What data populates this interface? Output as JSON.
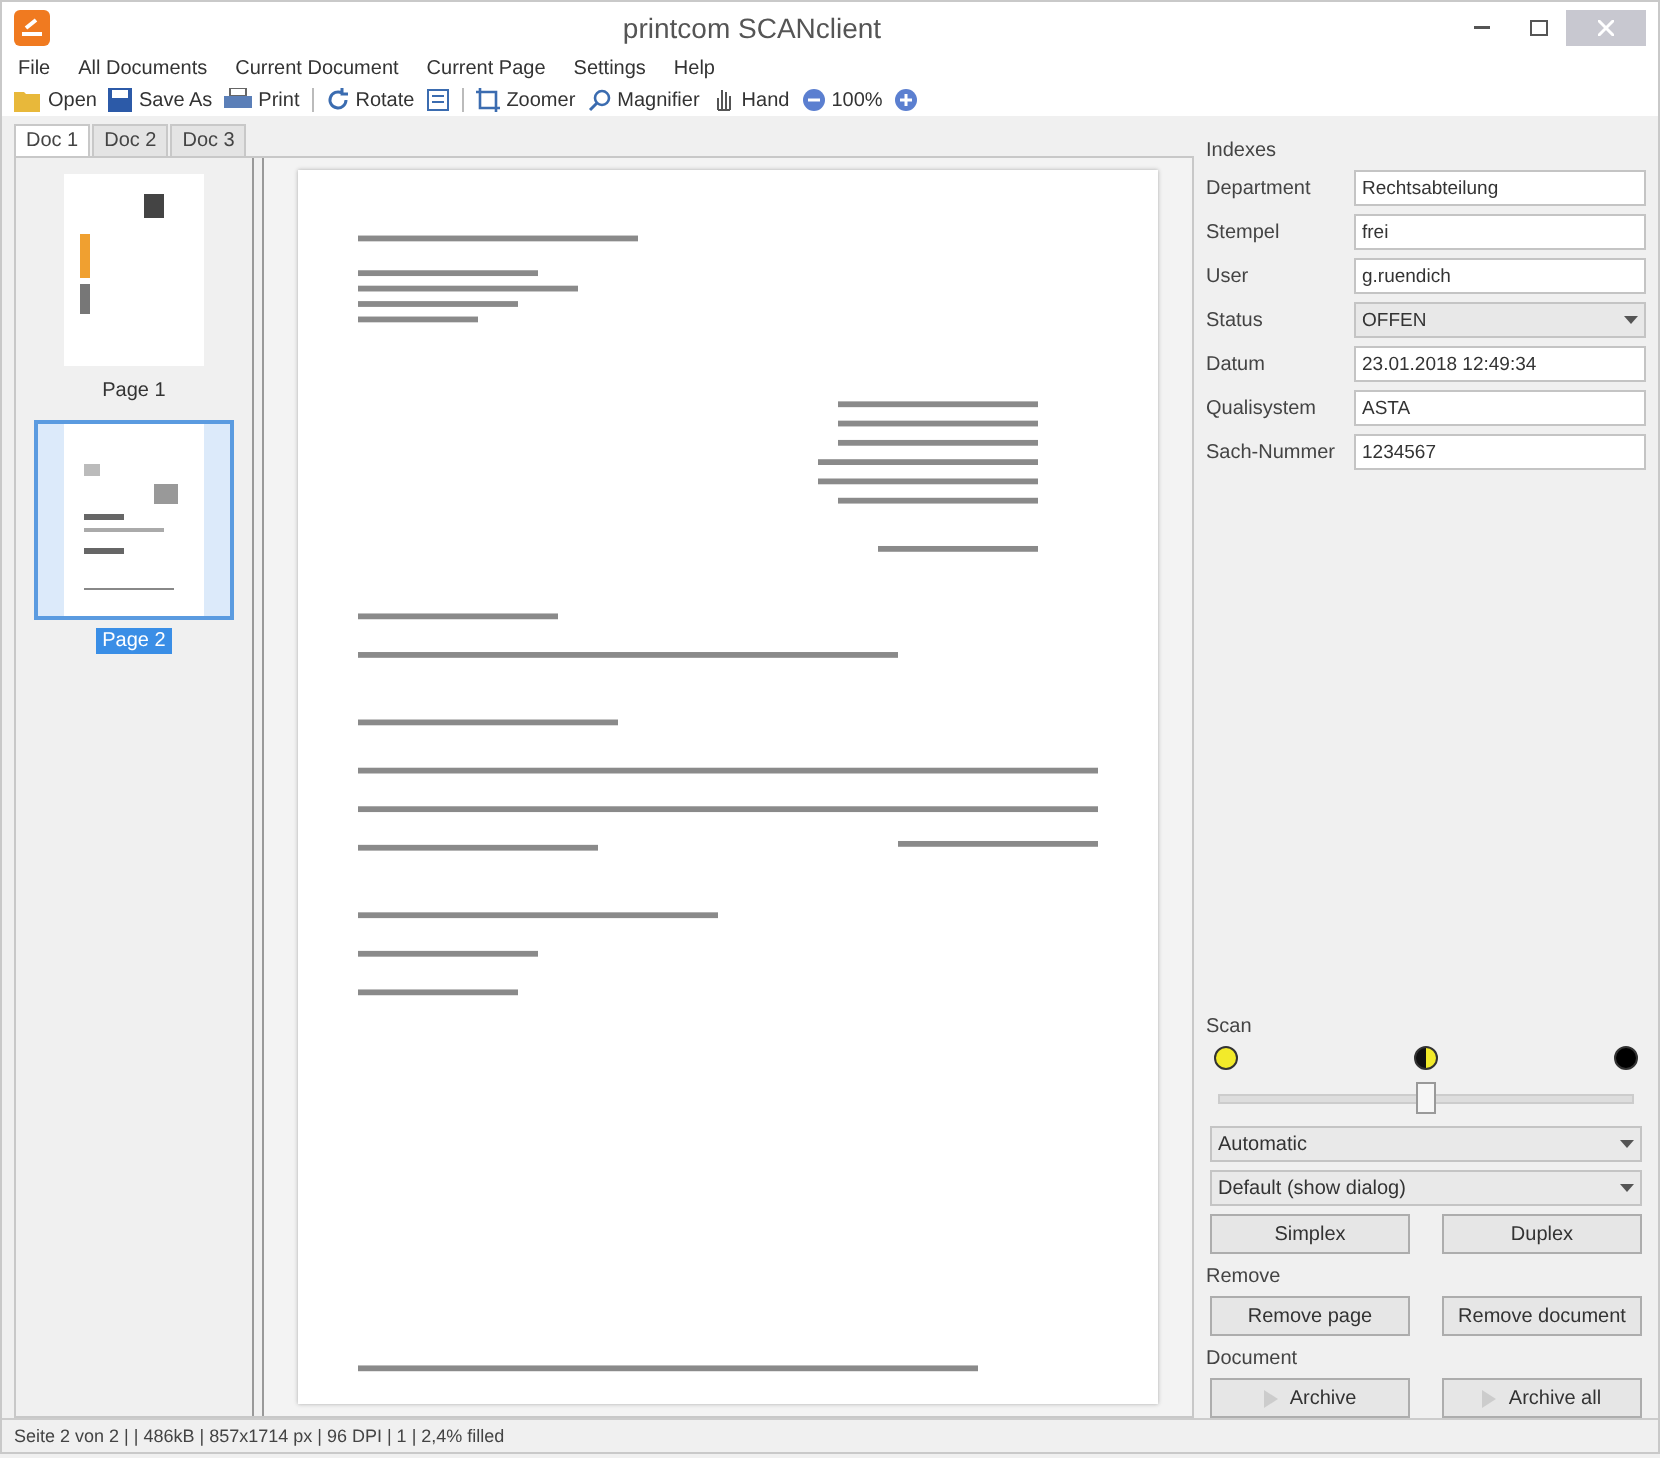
{
  "window": {
    "title": "printcom SCANclient"
  },
  "menu": [
    "File",
    "All Documents",
    "Current Document",
    "Current Page",
    "Settings",
    "Help"
  ],
  "toolbar": [
    {
      "kind": "open",
      "label": "Open"
    },
    {
      "kind": "save",
      "label": "Save As"
    },
    {
      "kind": "print",
      "label": "Print"
    },
    {
      "kind": "rotate",
      "label": "Rotate"
    },
    {
      "kind": "fit"
    },
    {
      "kind": "zoomer",
      "label": "Zoomer"
    },
    {
      "kind": "magnifier",
      "label": "Magnifier"
    },
    {
      "kind": "hand",
      "label": "Hand"
    },
    {
      "kind": "zoom-out",
      "label": "100%"
    },
    {
      "kind": "zoom-in"
    }
  ],
  "tabs": [
    {
      "label": "Doc 1",
      "selected": true
    },
    {
      "label": "Doc 2",
      "selected": false
    },
    {
      "label": "Doc 3",
      "selected": false
    }
  ],
  "pages": [
    {
      "label": "Page 1",
      "selected": false
    },
    {
      "label": "Page 2",
      "selected": true
    }
  ],
  "indexes": {
    "title": "Indexes",
    "fields": [
      {
        "label": "Department",
        "value": "Rechtsabteilung",
        "kind": "text"
      },
      {
        "label": "Stempel",
        "value": "frei",
        "kind": "text"
      },
      {
        "label": "User",
        "value": "g.ruendich",
        "kind": "text"
      },
      {
        "label": "Status",
        "value": "OFFEN",
        "kind": "select"
      },
      {
        "label": "Datum",
        "value": "23.01.2018 12:49:34",
        "kind": "text"
      },
      {
        "label": "Qualisystem",
        "value": "ASTA",
        "kind": "text"
      },
      {
        "label": "Sach-Nummer",
        "value": "1234567",
        "kind": "text"
      }
    ]
  },
  "scan": {
    "title": "Scan",
    "level": 0.5,
    "color_mode": "Automatic",
    "dialog": "Default (show dialog)",
    "buttons": [
      "Simplex",
      "Duplex"
    ]
  },
  "remove": {
    "title": "Remove",
    "buttons": [
      "Remove page",
      "Remove document"
    ]
  },
  "document": {
    "title": "Document",
    "buttons": [
      "Archive",
      "Archive all"
    ]
  },
  "status_bar": "Seite 2 von 2 | | 486kB | 857x1714 px | 96 DPI | 1 | 2,4% filled"
}
